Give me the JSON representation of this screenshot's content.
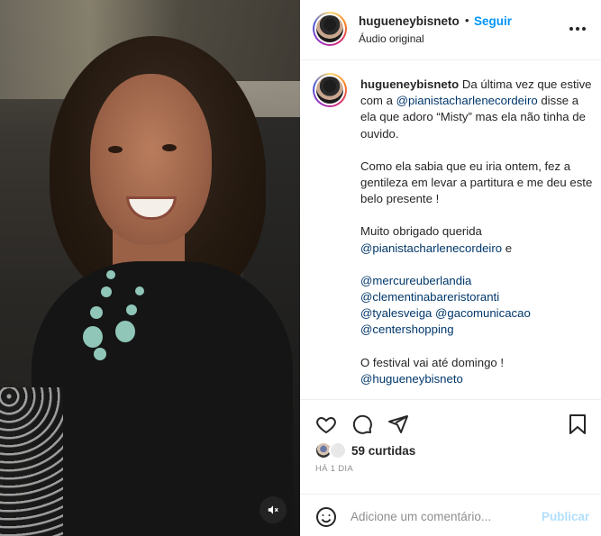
{
  "post": {
    "username": "hugueneybisneto",
    "separator": "•",
    "follow_label": "Seguir",
    "audio_label": "Áudio original",
    "more_icon": "more-horizontal-icon"
  },
  "caption": {
    "username": "hugueneybisneto",
    "lines": {
      "l1": "Da última vez que estive com a",
      "mention_charlene": "@pianistacharlenecordeiro",
      "l2": "disse a ela que adoro “Misty” mas ela não tinha de ouvido.",
      "p2": "Como ela sabia que eu iria ontem, fez a gentileza em levar a partitura e me deu este belo presente !",
      "p3a": "Muito obrigado querida",
      "p3_and": "e",
      "m_mercure": "@mercureuberlandia",
      "m_clementina": "@clementinabareristoranti",
      "m_tyales": "@tyalesveiga",
      "m_gaco": "@gacomunicacao",
      "m_center": "@centershopping",
      "p5": "O festival vai até domingo !",
      "m_huguenoy": "@hugueneybisneto"
    }
  },
  "actions": {
    "like_icon": "heart-icon",
    "comment_icon": "comment-icon",
    "share_icon": "share-icon",
    "save_icon": "bookmark-icon"
  },
  "likes": {
    "count": "59",
    "label": "curtidas"
  },
  "time_ago": "HÁ 1 DIA",
  "comment": {
    "placeholder": "Adicione um comentário...",
    "publish_label": "Publicar"
  },
  "colors": {
    "accent": "#0095f6",
    "mention": "#00376b",
    "publish_disabled": "#b2dffc",
    "muted": "#8e8e8e"
  }
}
